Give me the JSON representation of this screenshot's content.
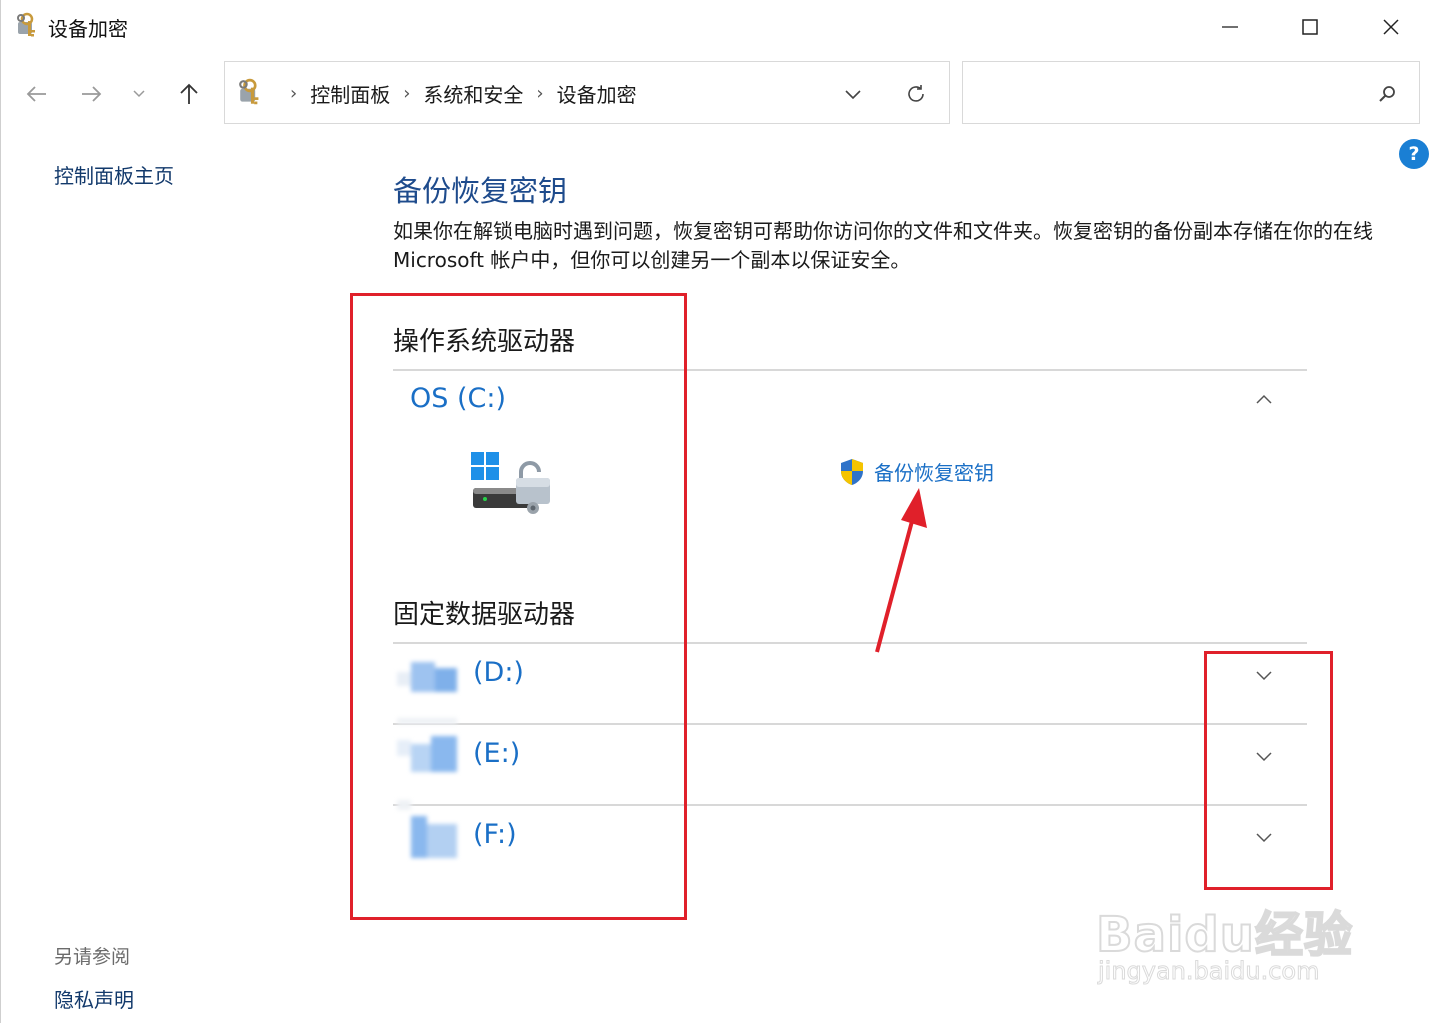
{
  "window": {
    "title": "设备加密"
  },
  "address": {
    "crumbs": [
      "控制面板",
      "系统和安全",
      "设备加密"
    ]
  },
  "search": {
    "placeholder": ""
  },
  "help": {
    "label": "?"
  },
  "sidebar": {
    "home": "控制面板主页",
    "see_also": "另请参阅",
    "privacy": "隐私声明"
  },
  "main": {
    "title": "备份恢复密钥",
    "description": "如果你在解锁电脑时遇到问题，恢复密钥可帮助你访问你的文件和文件夹。恢复密钥的备份副本存储在你的在线 Microsoft 帐户中，但你可以创建另一个副本以保证安全。",
    "os_section_title": "操作系统驱动器",
    "fixed_section_title": "固定数据驱动器",
    "os_drive": {
      "label": "OS (C:)",
      "action_label": "备份恢复密钥",
      "expanded": true
    },
    "fixed_drives": [
      {
        "label_suffix": "(D:)",
        "expanded": false
      },
      {
        "label_suffix": "(E:)",
        "expanded": false
      },
      {
        "label_suffix": "(F:)",
        "expanded": false
      }
    ]
  },
  "watermark": {
    "logo": "Baidu经验",
    "url": "jingyan.baidu.com"
  },
  "colors": {
    "link": "#1a6fc6",
    "nav_link": "#12396b",
    "title": "#1e4b8c",
    "annotation": "#e0202a",
    "help": "#1a7fd4"
  }
}
